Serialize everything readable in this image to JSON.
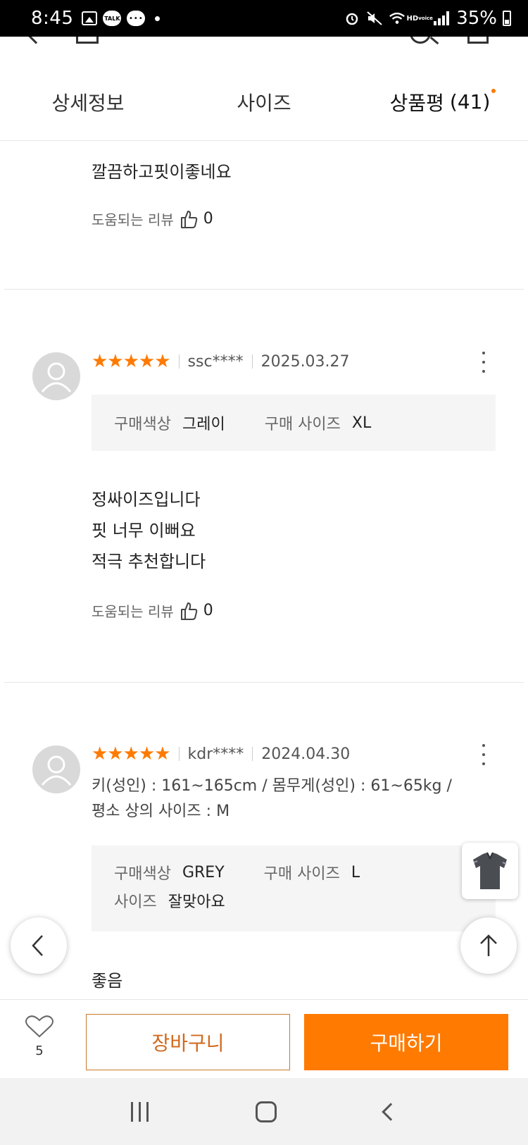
{
  "status_bar": {
    "time": "8:45",
    "talk_label": "TALK",
    "hd_label": "HD",
    "voice_label": "voice",
    "battery": "35%"
  },
  "tabs": [
    {
      "label": "상세정보"
    },
    {
      "label": "사이즈"
    },
    {
      "label": "상품평",
      "count": "(41)"
    }
  ],
  "review_partial": {
    "text": "깔끔하고핏이좋네요",
    "helpful_label": "도움되는 리뷰",
    "helpful_count": "0"
  },
  "reviews": [
    {
      "stars": "★★★★★",
      "user": "ssc****",
      "date": "2025.03.27",
      "options": {
        "color_label": "구매색상",
        "color_value": "그레이",
        "size_label": "구매 사이즈",
        "size_value": "XL"
      },
      "lines": [
        "정싸이즈입니다",
        "핏 너무 이뻐요",
        "적극 추천합니다"
      ],
      "helpful_label": "도움되는 리뷰",
      "helpful_count": "0"
    },
    {
      "stars": "★★★★★",
      "user": "kdr****",
      "date": "2024.04.30",
      "profile_line1": "키(성인) : 161~165cm / 몸무게(성인) : 61~65kg /",
      "profile_line2": "평소 상의 사이즈 : M",
      "options": {
        "color_label": "구매색상",
        "color_value": "GREY",
        "size_label": "구매 사이즈",
        "size_value": "L",
        "fit_label": "사이즈",
        "fit_value": "잘맞아요"
      },
      "lines": [
        "좋음"
      ]
    }
  ],
  "bottom_bar": {
    "wish_count": "5",
    "cart_label": "장바구니",
    "buy_label": "구매하기"
  },
  "colors": {
    "accent": "#ff7a00",
    "cart_border": "#c9782a"
  }
}
